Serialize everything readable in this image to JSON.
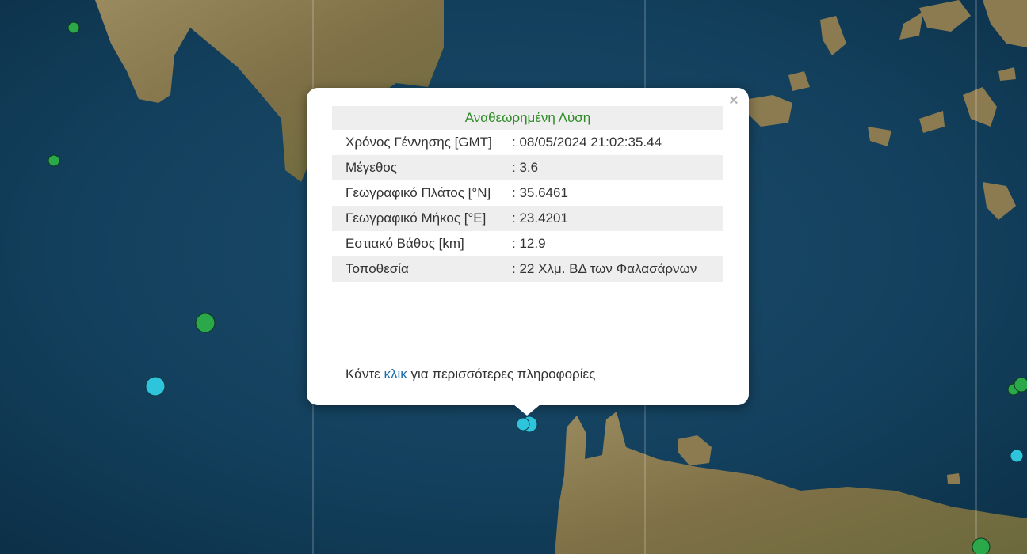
{
  "popup": {
    "title": "Αναθεωρημένη Λύση",
    "close_label": "×",
    "rows": [
      {
        "label": "Χρόνος Γέννησης [GMT]",
        "value": ": 08/05/2024 21:02:35.44"
      },
      {
        "label": "Μέγεθος",
        "value": ": 3.6"
      },
      {
        "label": "Γεωγραφικό Πλάτος [°N]",
        "value": ": 35.6461"
      },
      {
        "label": "Γεωγραφικό Μήκος [°E]",
        "value": ": 23.4201"
      },
      {
        "label": "Εστιακό Βάθος [km]",
        "value": ": 12.9"
      },
      {
        "label": "Τοποθεσία",
        "value": ": 22 Χλμ. ΒΔ των Φαλασάρνων"
      }
    ],
    "footer": {
      "prefix": "Κάντε",
      "link": "κλικ",
      "suffix": "για περισσότερες πληροφορίες"
    }
  },
  "colors": {
    "sea": "#0f3a55",
    "land": "#8a7a52",
    "marker_green": "#2aa84a",
    "marker_cyan": "#2ec4dc",
    "title_green": "#2e8b27",
    "link_blue": "#1a6fa8"
  }
}
